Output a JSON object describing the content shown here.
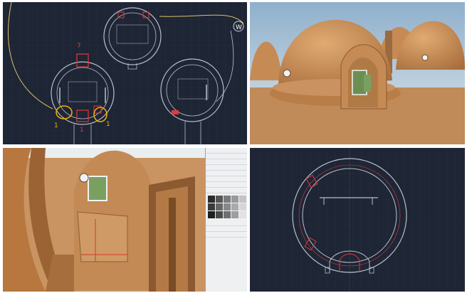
{
  "cad_top": {
    "annotations": [
      {
        "text": "7",
        "color": "#e03a3a"
      },
      {
        "text": "1",
        "color": "#f0b400"
      },
      {
        "text": "1",
        "color": "#f0b400"
      },
      {
        "text": "1",
        "color": "#e03a3a"
      }
    ],
    "compass_label": "W"
  },
  "render_bottom": {
    "tray_rows": 12,
    "swatch_colors": [
      "#2b2b2b",
      "#555555",
      "#7a7a7a",
      "#9a9a9a",
      "#c4c4c4",
      "#3a3a3a",
      "#666666",
      "#888888",
      "#aaaaaa",
      "#d6d6d6",
      "#1f1f1f",
      "#4a4a4a",
      "#707070",
      "#9e9e9e",
      "#e2e2e2"
    ]
  },
  "colors": {
    "cad_bg": "#1e2535",
    "cad_line": "#b9c0cc",
    "cad_red": "#e03a3a",
    "cad_yellow": "#f0b400",
    "earth": "#c8935f",
    "sky": "#a9c1d6"
  }
}
